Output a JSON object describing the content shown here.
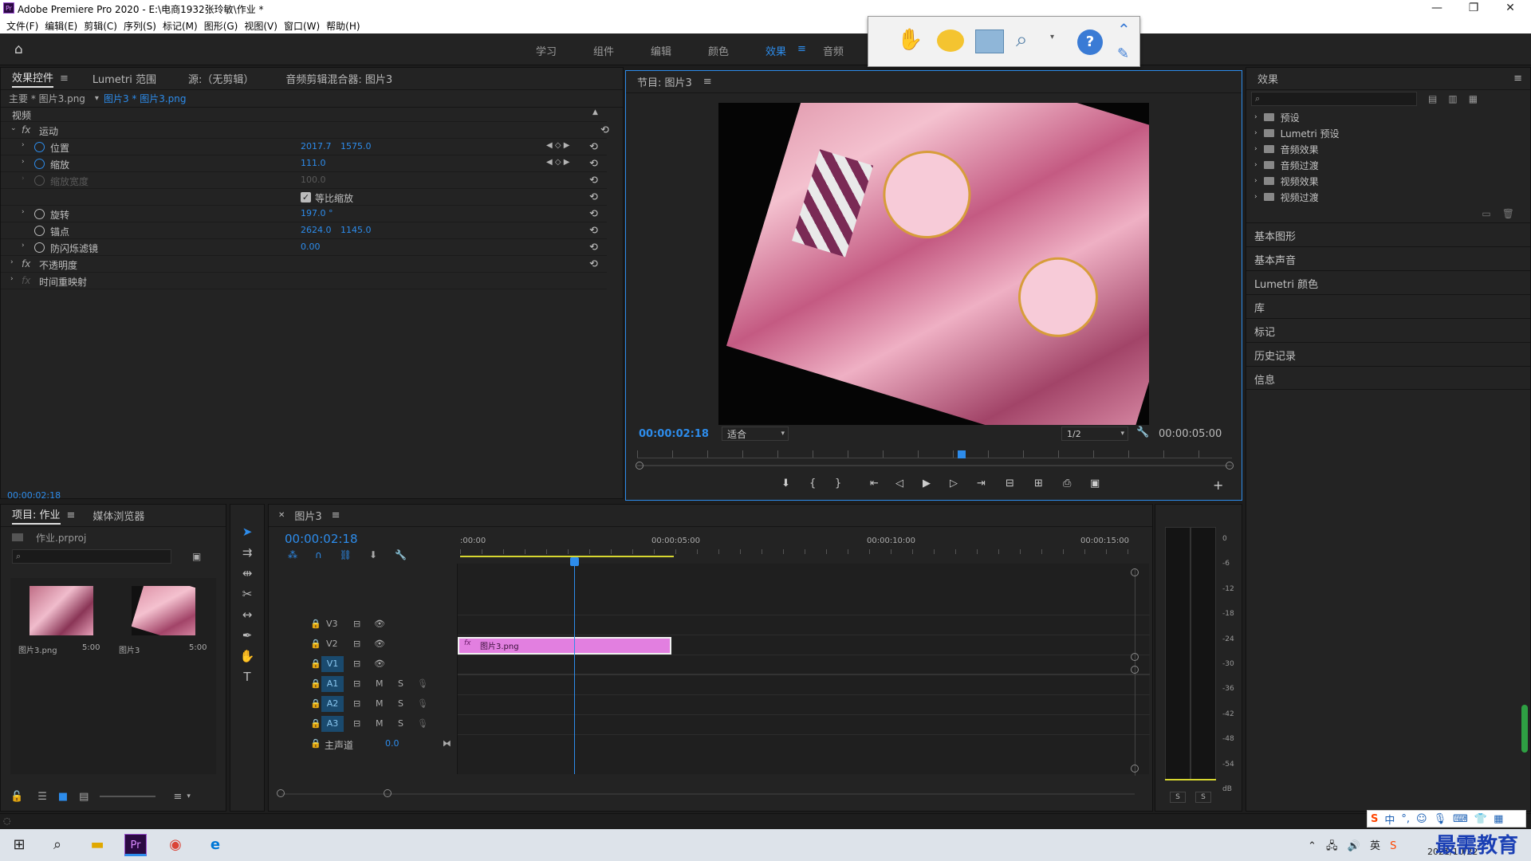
{
  "app": {
    "title": "Adobe Premiere Pro 2020 - E:\\电商1932张玲敏\\作业 *"
  },
  "menu": [
    "文件(F)",
    "编辑(E)",
    "剪辑(C)",
    "序列(S)",
    "标记(M)",
    "图形(G)",
    "视图(V)",
    "窗口(W)",
    "帮助(H)"
  ],
  "workspaces": [
    "学习",
    "组件",
    "编辑",
    "颜色",
    "效果",
    "音频"
  ],
  "active_workspace": "效果",
  "effect_controls": {
    "tabs": [
      "效果控件",
      "Lumetri 范围",
      "源:（无剪辑）",
      "音频剪辑混合器: 图片3"
    ],
    "master": "主要 * 图片3.png",
    "clip": "图片3 * 图片3.png",
    "video_header": "视频",
    "motion": "运动",
    "position_label": "位置",
    "position_x": "2017.7",
    "position_y": "1575.0",
    "scale_label": "缩放",
    "scale_value": "111.0",
    "scale_width_label": "缩放宽度",
    "scale_width_value": "100.0",
    "uniform_scale_label": "等比缩放",
    "rotation_label": "旋转",
    "rotation_value": "197.0 °",
    "anchor_label": "锚点",
    "anchor_x": "2624.0",
    "anchor_y": "1145.0",
    "flicker_label": "防闪烁滤镜",
    "flicker_value": "0.00",
    "opacity": "不透明度",
    "time_remap": "时间重映射",
    "timecode": "00:00:02:18"
  },
  "program": {
    "title": "节目: 图片3",
    "timecode": "00:00:02:18",
    "fit": "适合",
    "resolution": "1/2",
    "duration": "00:00:05:00"
  },
  "effects_panel": {
    "title": "效果",
    "items": [
      "预设",
      "Lumetri 预设",
      "音频效果",
      "音频过渡",
      "视频效果",
      "视频过渡"
    ],
    "sections": [
      "基本图形",
      "基本声音",
      "Lumetri 颜色",
      "库",
      "标记",
      "历史记录",
      "信息"
    ]
  },
  "project": {
    "tabs": [
      "项目: 作业",
      "媒体浏览器"
    ],
    "file": "作业.prproj",
    "items": [
      {
        "name": "图片3.png",
        "dur": "5:00"
      },
      {
        "name": "图片3",
        "dur": "5:00"
      }
    ]
  },
  "timeline": {
    "tab": "图片3",
    "timecode": "00:00:02:18",
    "ruler": [
      ":00:00",
      "00:00:05:00",
      "00:00:10:00",
      "00:00:15:00"
    ],
    "tracks_video": [
      "V3",
      "V2",
      "V1"
    ],
    "tracks_audio": [
      "A1",
      "A2",
      "A3"
    ],
    "master_label": "主声道",
    "master_value": "0.0",
    "clip_name": "图片3.png",
    "m_label": "M",
    "s_label": "S"
  },
  "meter": {
    "ticks": [
      "0",
      "-6",
      "-12",
      "-18",
      "-24",
      "-30",
      "-36",
      "-42",
      "-48",
      "-54",
      "dB"
    ],
    "solo": [
      "S",
      "S"
    ]
  },
  "taskbar": {
    "date": "2021/10/22",
    "ime": "中",
    "watermark": "最需教育"
  },
  "colors": {
    "accent": "#2d8ceb",
    "clip": "#e27fe0",
    "bg": "#232323"
  }
}
